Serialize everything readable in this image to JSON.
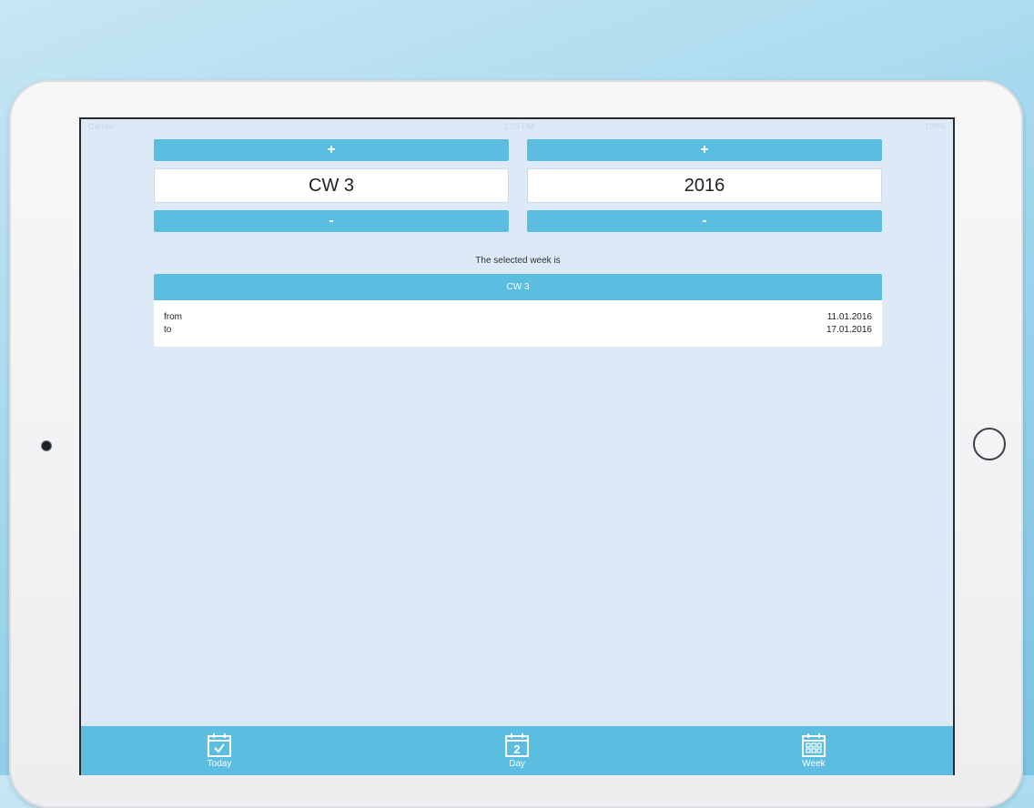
{
  "status_bar": {
    "carrier": "Carrier",
    "time": "1:03 PM",
    "battery": "100%"
  },
  "week_stepper": {
    "increment_label": "+",
    "value": "CW 3",
    "decrement_label": "-"
  },
  "year_stepper": {
    "increment_label": "+",
    "value": "2016",
    "decrement_label": "-"
  },
  "result": {
    "caption": "The selected week is",
    "header": "CW 3",
    "rows": [
      {
        "label": "from",
        "value": "11.01.2016"
      },
      {
        "label": "to",
        "value": "17.01.2016"
      }
    ]
  },
  "tab_bar": {
    "tabs": [
      {
        "label": "Today",
        "icon": "calendar-check-icon"
      },
      {
        "label": "Day",
        "icon": "calendar-day-icon",
        "day_number": "2"
      },
      {
        "label": "Week",
        "icon": "calendar-grid-icon"
      }
    ]
  },
  "colors": {
    "accent": "#5bbde0",
    "screen_background": "#dbeaf6"
  }
}
